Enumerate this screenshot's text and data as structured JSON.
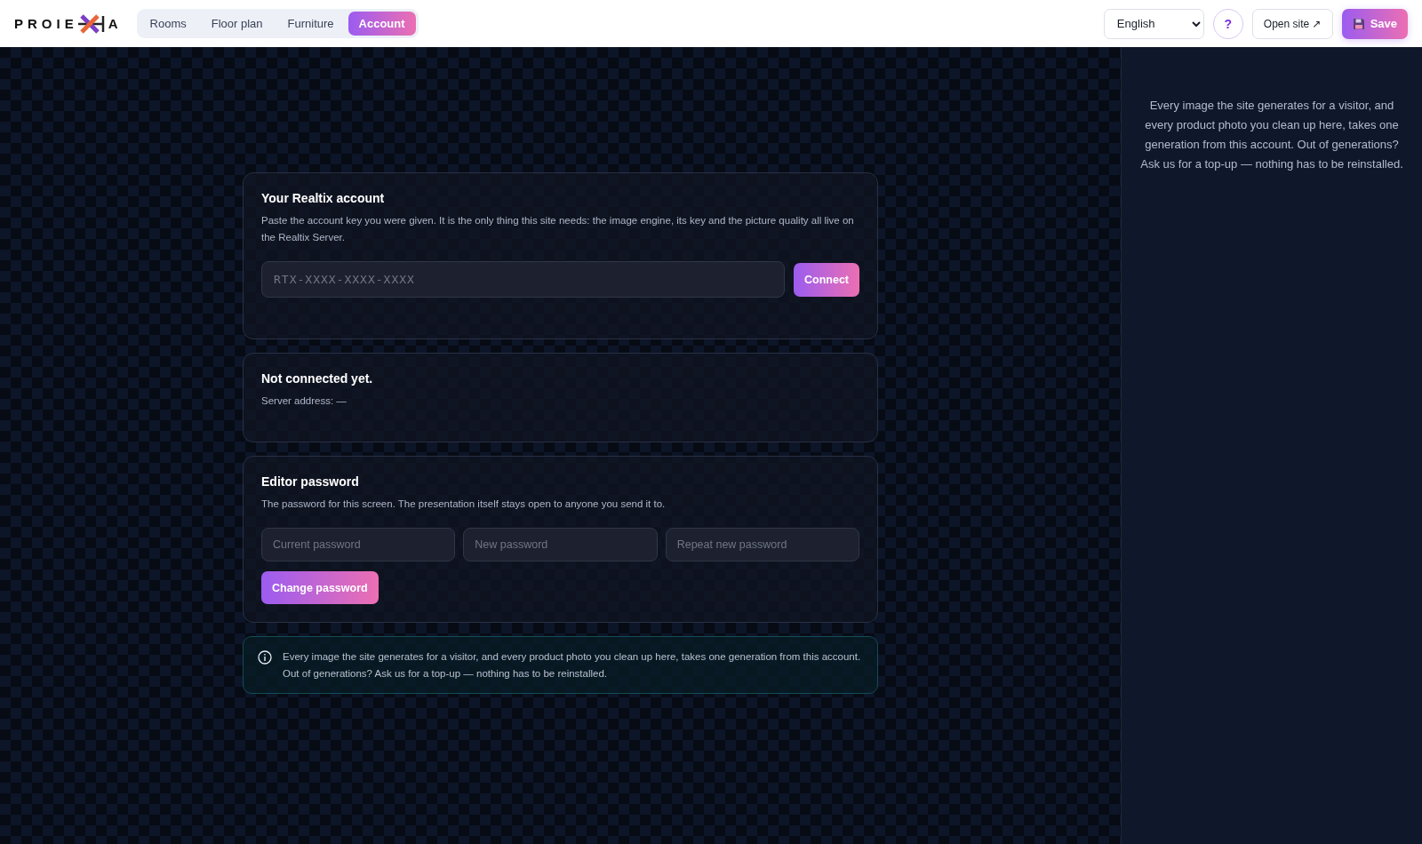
{
  "logo": {
    "left": "PROIE",
    "right": "A"
  },
  "tabs": [
    {
      "label": "Rooms",
      "selected": false
    },
    {
      "label": "Floor plan",
      "selected": false
    },
    {
      "label": "Furniture",
      "selected": false
    },
    {
      "label": "Account",
      "selected": true
    }
  ],
  "header_actions": {
    "language": "English",
    "help": "?",
    "open_site": "Open site ↗",
    "save": "Save"
  },
  "account_card": {
    "title": "Your Realtix account",
    "description": "Paste the account key you were given. It is the only thing this site needs: the image engine, its key and the picture quality all live on the Realtix Server.",
    "key_field": {
      "placeholder": "RTX-XXXX-XXXX-XXXX"
    },
    "button": "Connect"
  },
  "status_card": {
    "title": "Not connected yet.",
    "server_address": "Server address: —"
  },
  "password_card": {
    "title": "Editor password",
    "description": "The password for this screen. The presentation itself stays open to anyone you send it to.",
    "fields": [
      {
        "placeholder": "Current password"
      },
      {
        "placeholder": "New password"
      },
      {
        "placeholder": "Repeat new password"
      }
    ],
    "button": "Change password"
  },
  "info_note": "Every image the site generates for a visitor, and every product photo you clean up here, takes one generation from this account. Out of generations? Ask us for a top-up — nothing has to be reinstalled.",
  "side_panel": {
    "text": "Every image the site generates for a visitor, and every product photo you clean up here, takes one generation from this account. Out of generations? Ask us for a top-up — nothing has to be reinstalled."
  }
}
